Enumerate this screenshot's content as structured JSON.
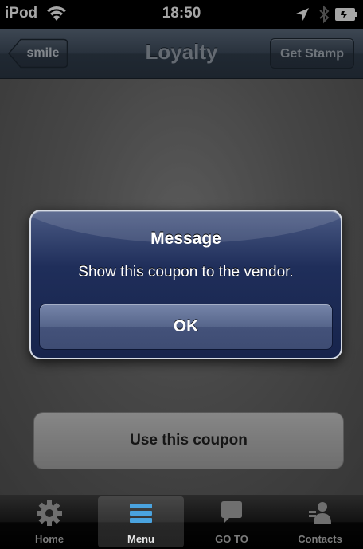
{
  "status_bar": {
    "carrier": "iPod",
    "time": "18:50"
  },
  "nav_bar": {
    "title": "Loyalty",
    "back_button": "smile",
    "right_button": "Get Stamp"
  },
  "content": {
    "use_coupon_button": "Use this coupon"
  },
  "alert": {
    "title": "Message",
    "message": "Show this coupon to the vendor.",
    "ok_button": "OK"
  },
  "tab_bar": {
    "tabs": [
      {
        "label": "Home",
        "icon": "gear-icon"
      },
      {
        "label": "Menu",
        "icon": "menu-icon"
      },
      {
        "label": "GO TO",
        "icon": "speech-bubble-icon"
      },
      {
        "label": "Contacts",
        "icon": "contacts-icon"
      }
    ],
    "selected_tab": "Menu"
  },
  "colors": {
    "nav_bar": "#3f4d5e",
    "alert_background": "#1f2e5a",
    "alert_border": "#d6dbe4",
    "tab_bar": "#000000"
  }
}
